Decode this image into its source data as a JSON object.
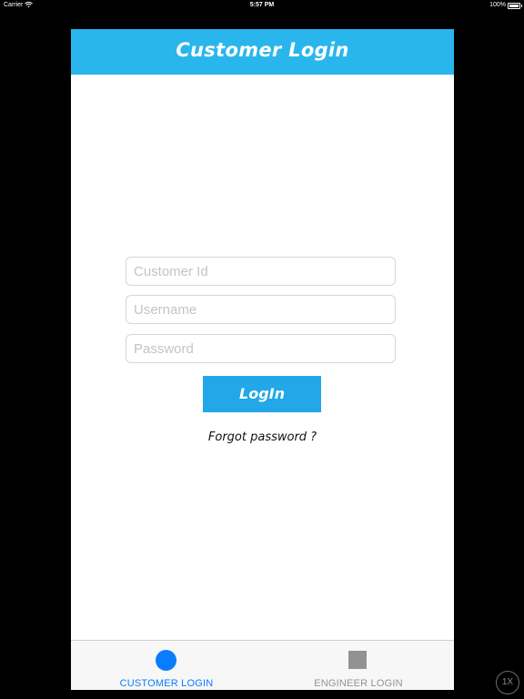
{
  "status_bar": {
    "carrier": "Carrier",
    "time": "5:57 PM",
    "battery": "100%",
    "icons": [
      "wifi-icon",
      "battery-icon"
    ]
  },
  "navbar": {
    "title": "Customer Login"
  },
  "form": {
    "customer_id_placeholder": "Customer Id",
    "customer_id_value": "",
    "username_placeholder": "Username",
    "username_value": "",
    "password_placeholder": "Password",
    "password_value": "",
    "login_label": "LogIn",
    "forgot_label": "Forgot password ?"
  },
  "tabbar": {
    "items": [
      {
        "label": "CUSTOMER LOGIN",
        "icon": "circle-icon",
        "selected": true
      },
      {
        "label": "ENGINEER LOGIN",
        "icon": "square-icon",
        "selected": false
      }
    ]
  },
  "zoom": {
    "label": "1X"
  },
  "colors": {
    "navbar": "#29b6ec",
    "button": "#22a7e8",
    "tab_selected": "#0a7cff",
    "tab_unselected": "#929292"
  }
}
